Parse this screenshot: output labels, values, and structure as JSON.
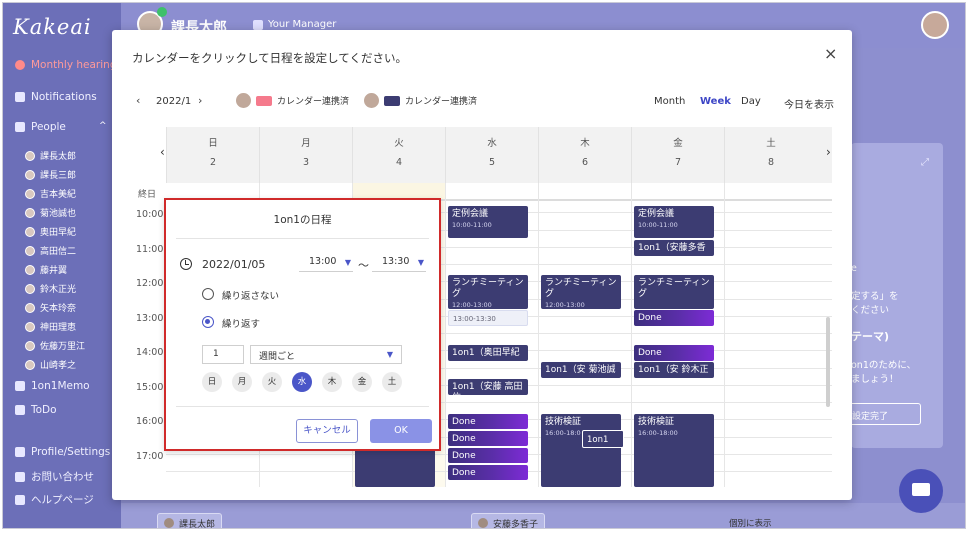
{
  "app": {
    "logo": "Kakeai",
    "user_name": "課長太郎",
    "manager_label": "Your Manager"
  },
  "sidebar": {
    "nav": [
      "Monthly hearing",
      "Notifications",
      "People"
    ],
    "people": [
      "課長太郎",
      "課長三郎",
      "吉本美紀",
      "菊池誠也",
      "奥田早紀",
      "高田信二",
      "藤井翼",
      "鈴木正光",
      "矢本玲奈",
      "神田理恵",
      "佐藤万里江",
      "山崎孝之"
    ],
    "bottom_nav": [
      "1on1Memo",
      "ToDo",
      "Profile/Settings",
      "お問い合わせ",
      "ヘルプページ"
    ]
  },
  "background": {
    "card_lines": [
      "e",
      "定する」を",
      "ください",
      "テーマ)",
      "on1のために、",
      "ましょう！"
    ],
    "card_button": "設定完了",
    "chips": [
      "課長太郎",
      "安藤多香子"
    ],
    "link": "個別に表示"
  },
  "modal": {
    "title": "カレンダーをクリックして日程を設定してください。",
    "close_icon": "×",
    "month": "2022/1",
    "legend": [
      {
        "label": "カレンダー連携済",
        "color": "#f57a8c"
      },
      {
        "label": "カレンダー連携済",
        "color": "#3c3c72"
      }
    ],
    "views": [
      "Month",
      "Week",
      "Day"
    ],
    "active_view": "Week",
    "today_label": "今日を表示"
  },
  "calendar": {
    "allday_label": "終日",
    "days": [
      {
        "name": "日",
        "date": "2"
      },
      {
        "name": "月",
        "date": "3"
      },
      {
        "name": "火",
        "date": "4"
      },
      {
        "name": "水",
        "date": "5"
      },
      {
        "name": "木",
        "date": "6"
      },
      {
        "name": "金",
        "date": "7"
      },
      {
        "name": "土",
        "date": "8"
      }
    ],
    "times": [
      "10:00",
      "11:00",
      "12:00",
      "13:00",
      "14:00",
      "15:00",
      "16:00",
      "17:00"
    ],
    "events": {
      "wed_meeting": {
        "title": "定例会議",
        "time": "10:00-11:00"
      },
      "wed_lunch": {
        "title": "ランチミーティング",
        "time": "12:00-13:00"
      },
      "wed_light": {
        "time": "13:00-13:30"
      },
      "wed_1on1_a": {
        "title": "1on1（奥田早紀"
      },
      "wed_1on1_b": {
        "title": "1on1（安藤 高田信"
      },
      "wed_done": [
        "Done",
        "Done",
        "Done",
        "Done"
      ],
      "thu_lunch": {
        "title": "ランチミーティング",
        "time": "12:00-13:00"
      },
      "thu_1on1": {
        "title": "1on1（安 菊池誠"
      },
      "thu_tech": {
        "title": "技術検証",
        "time": "16:00-18:0"
      },
      "thu_split": {
        "title": "1on1"
      },
      "fri_meeting": {
        "title": "定例会議",
        "time": "10:00-11:00"
      },
      "fri_1on1_a": {
        "title": "1on1（安藤多香"
      },
      "fri_lunch": {
        "title": "ランチミーティング",
        "time": "12:00-13:00"
      },
      "fri_done_a": "Done",
      "fri_done_b": "Done",
      "fri_1on1_b": {
        "title": "1on1（安 鈴木正"
      },
      "fri_tech": {
        "title": "技術検証",
        "time": "16:00-18:00"
      }
    }
  },
  "popup": {
    "title": "1on1の日程",
    "date": "2022/01/05",
    "start": "13:00",
    "tilde": "〜",
    "end": "13:30",
    "no_repeat": "繰り返さない",
    "repeat": "繰り返す",
    "interval": "1",
    "frequency": "週間ごと",
    "weekdays": [
      "日",
      "月",
      "火",
      "水",
      "木",
      "金",
      "土"
    ],
    "selected_weekday": "水",
    "cancel_label": "キャンセル",
    "ok_label": "OK"
  }
}
